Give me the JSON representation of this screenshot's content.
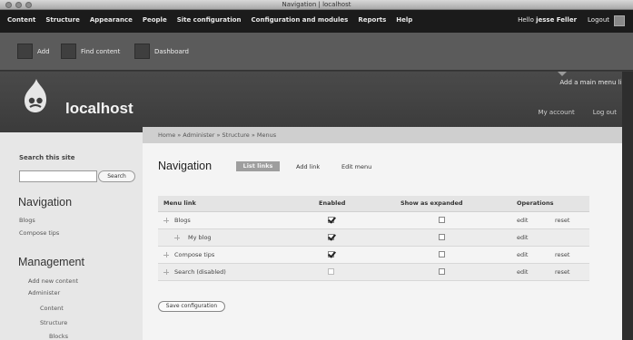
{
  "window": {
    "title": "Navigation | localhost"
  },
  "admin_bar": {
    "menu": [
      "Content",
      "Structure",
      "Appearance",
      "People",
      "Site configuration",
      "Configuration and modules",
      "Reports",
      "Help"
    ],
    "user_greeting": "Hello",
    "user_name": "jesse Feller",
    "logout": "Logout"
  },
  "shortcuts": [
    "Add",
    "Find content",
    "Dashboard"
  ],
  "header": {
    "site_name": "localhost",
    "add_menu_link": "Add a main menu link",
    "my_account": "My account",
    "log_out": "Log out"
  },
  "sidebar": {
    "search_title": "Search this site",
    "search_button": "Search",
    "navigation_title": "Navigation",
    "navigation_items": [
      "Blogs",
      "Compose tips"
    ],
    "management_title": "Management",
    "management_items": [
      "Add new content",
      "Administer",
      "Content",
      "Structure",
      "Blocks"
    ]
  },
  "breadcrumb": "Home » Administer » Structure » Menus",
  "page": {
    "title": "Navigation",
    "tabs": [
      "List links",
      "Add link",
      "Edit menu"
    ]
  },
  "table": {
    "headers": [
      "Menu link",
      "Enabled",
      "Show as expanded",
      "Operations"
    ],
    "rows": [
      {
        "label": "Blogs",
        "enabled": true,
        "expanded": false,
        "ops": [
          "edit",
          "reset"
        ]
      },
      {
        "label": "My blog",
        "enabled": true,
        "expanded": false,
        "ops": [
          "edit"
        ]
      },
      {
        "label": "Compose tips",
        "enabled": true,
        "expanded": false,
        "ops": [
          "edit",
          "reset"
        ]
      },
      {
        "label": "Search (disabled)",
        "enabled": false,
        "expanded": false,
        "ops": [
          "edit",
          "reset"
        ]
      }
    ]
  },
  "save_button": "Save configuration"
}
